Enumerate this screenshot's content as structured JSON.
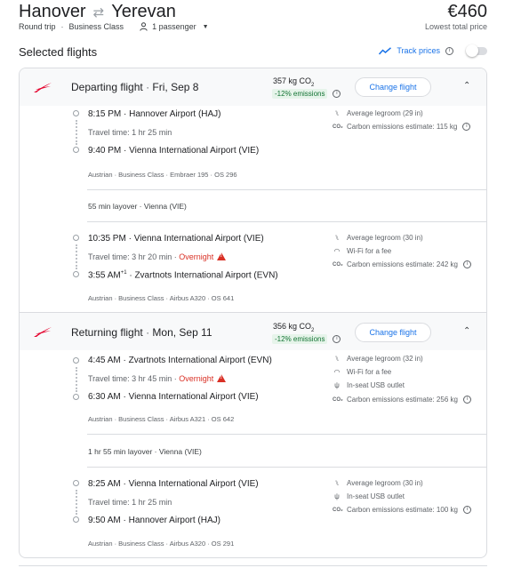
{
  "header": {
    "origin": "Hanover",
    "destination": "Yerevan",
    "swap_icon": "arrows-swap-icon",
    "trip_type": "Round trip",
    "cabin": "Business Class",
    "passengers": "1 passenger",
    "price": "€460",
    "price_note": "Lowest total price"
  },
  "selected": {
    "title": "Selected flights",
    "track_label": "Track prices"
  },
  "departing": {
    "label": "Departing flight",
    "date": "Fri, Sep 8",
    "co2_value": "357 kg CO",
    "co2_sub": "2",
    "emissions": "-12% emissions",
    "button": "Change flight",
    "leg1": {
      "dep_time": "8:15 PM",
      "dep_airport": "Hannover Airport (HAJ)",
      "travel": "Travel time: 1 hr 25 min",
      "arr_time": "9:40 PM",
      "arr_airport": "Vienna International Airport (VIE)",
      "meta": "Austrian · Business Class · Embraer 195 · OS 296",
      "amenities": [
        "Average legroom (29 in)",
        "Carbon emissions estimate: 115 kg"
      ]
    },
    "layover": "55 min layover · Vienna (VIE)",
    "leg2": {
      "dep_time": "10:35 PM",
      "dep_airport": "Vienna International Airport (VIE)",
      "travel": "Travel time: 3 hr 20 min · ",
      "overnight": "Overnight",
      "arr_time": "3:55 AM",
      "arr_sup": "+1",
      "arr_airport": "Zvartnots International Airport (EVN)",
      "meta": "Austrian · Business Class · Airbus A320 · OS 641",
      "amenities": [
        "Average legroom (30 in)",
        "Wi-Fi for a fee",
        "Carbon emissions estimate: 242 kg"
      ]
    }
  },
  "returning": {
    "label": "Returning flight",
    "date": "Mon, Sep 11",
    "co2_value": "356 kg CO",
    "co2_sub": "2",
    "emissions": "-12% emissions",
    "button": "Change flight",
    "leg1": {
      "dep_time": "4:45 AM",
      "dep_airport": "Zvartnots International Airport (EVN)",
      "travel": "Travel time: 3 hr 45 min · ",
      "overnight": "Overnight",
      "arr_time": "6:30 AM",
      "arr_airport": "Vienna International Airport (VIE)",
      "meta": "Austrian · Business Class · Airbus A321 · OS 642",
      "amenities": [
        "Average legroom (32 in)",
        "Wi-Fi for a fee",
        "In-seat USB outlet",
        "Carbon emissions estimate: 256 kg"
      ]
    },
    "layover": "1 hr 55 min layover · Vienna (VIE)",
    "leg2": {
      "dep_time": "8:25 AM",
      "dep_airport": "Vienna International Airport (VIE)",
      "travel": "Travel time: 1 hr 25 min",
      "arr_time": "9:50 AM",
      "arr_airport": "Hannover Airport (HAJ)",
      "meta": "Austrian · Business Class · Airbus A320 · OS 291",
      "amenities": [
        "Average legroom (30 in)",
        "In-seat USB outlet",
        "Carbon emissions estimate: 100 kg"
      ]
    }
  },
  "colors": {
    "accent": "#1a73e8",
    "austrian_red": "#e4002b",
    "green": "#137333",
    "warning": "#d93025"
  }
}
